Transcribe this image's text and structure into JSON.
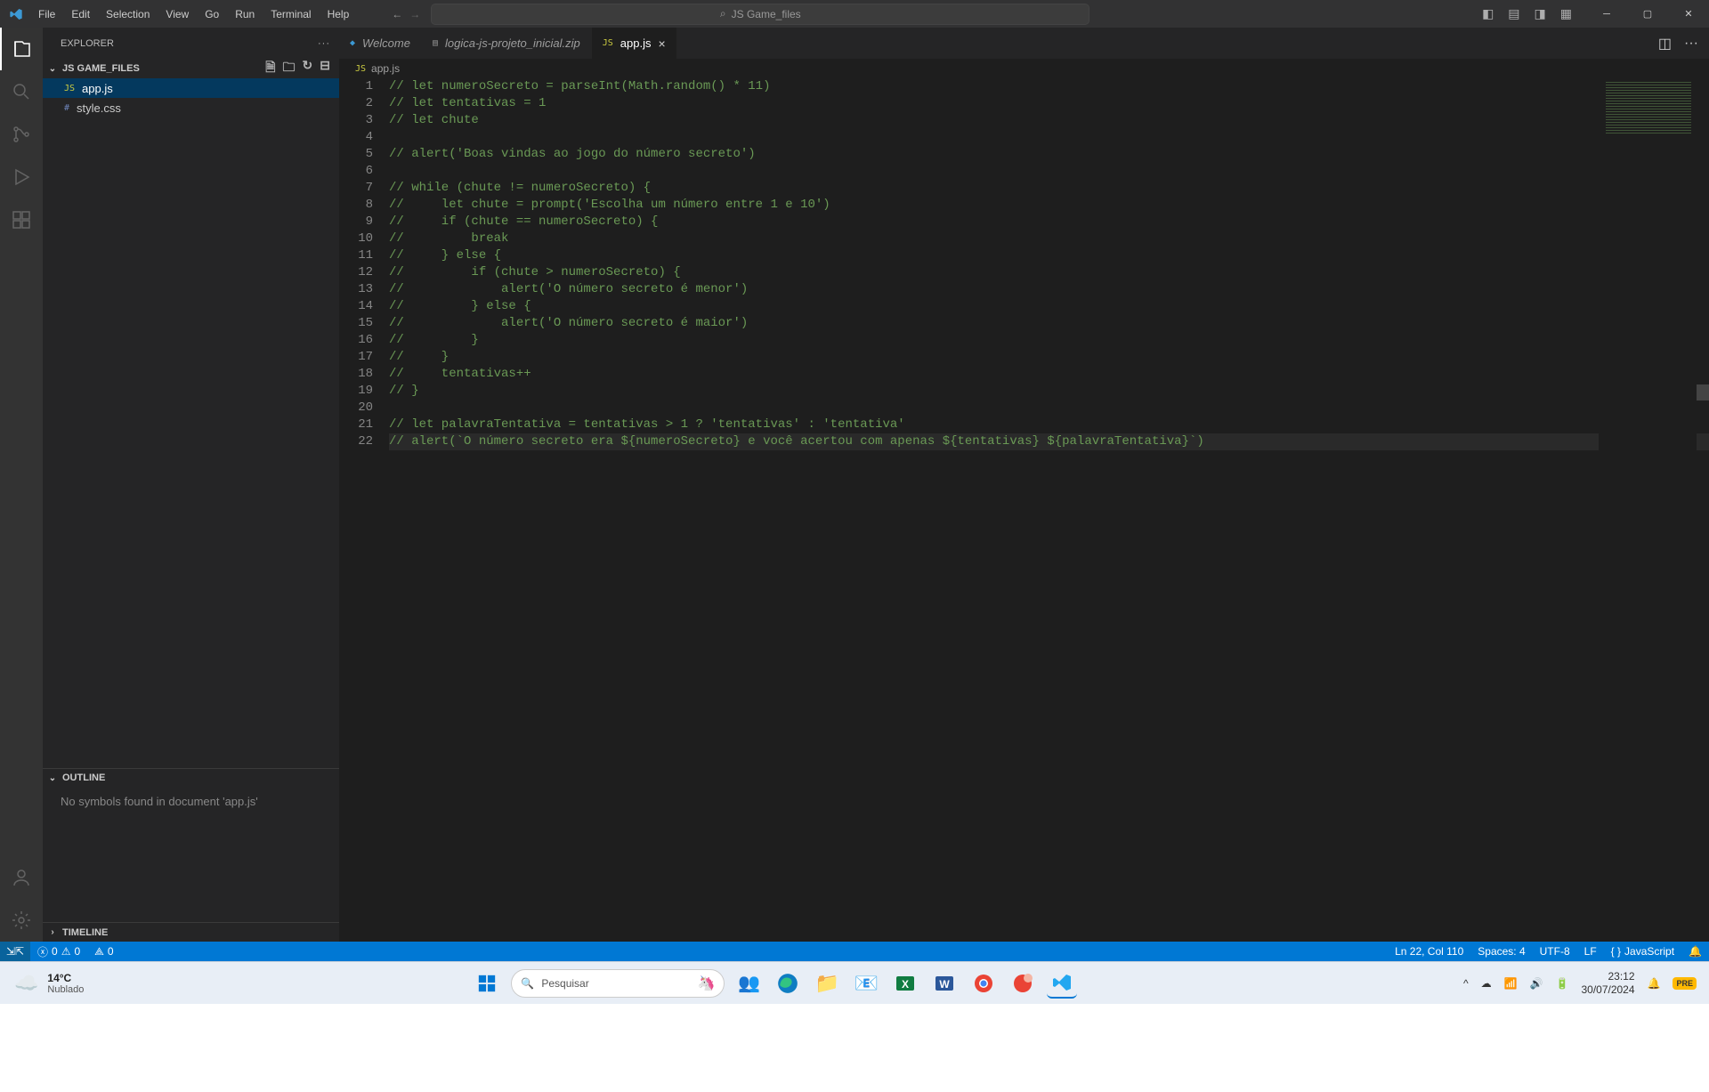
{
  "menu": [
    "File",
    "Edit",
    "Selection",
    "View",
    "Go",
    "Run",
    "Terminal",
    "Help"
  ],
  "search_placeholder": "JS Game_files",
  "sidebar": {
    "title": "EXPLORER",
    "folder": "JS GAME_FILES",
    "files": [
      {
        "icon": "JS",
        "name": "app.js",
        "active": true
      },
      {
        "icon": "#",
        "name": "style.css",
        "active": false
      }
    ],
    "outline": {
      "title": "OUTLINE",
      "message": "No symbols found in document 'app.js'"
    },
    "timeline": {
      "title": "TIMELINE"
    }
  },
  "tabs": [
    {
      "icon": "vs",
      "label": "Welcome",
      "active": false,
      "close": false
    },
    {
      "icon": "zip",
      "label": "logica-js-projeto_inicial.zip",
      "active": false,
      "close": false
    },
    {
      "icon": "js",
      "label": "app.js",
      "active": true,
      "close": true
    }
  ],
  "breadcrumb": {
    "icon": "JS",
    "label": "app.js"
  },
  "code": {
    "lines": [
      "// let numeroSecreto = parseInt(Math.random() * 11)",
      "// let tentativas = 1",
      "// let chute",
      "",
      "// alert('Boas vindas ao jogo do número secreto')",
      "",
      "// while (chute != numeroSecreto) {",
      "//     let chute = prompt('Escolha um número entre 1 e 10')",
      "//     if (chute == numeroSecreto) {",
      "//         break",
      "//     } else {",
      "//         if (chute > numeroSecreto) {",
      "//             alert('O número secreto é menor')",
      "//         } else {",
      "//             alert('O número secreto é maior')",
      "//         }",
      "//     }",
      "//     tentativas++",
      "// }",
      "",
      "// let palavraTentativa = tentativas > 1 ? 'tentativas' : 'tentativa'",
      "// alert(`O número secreto era ${numeroSecreto} e você acertou com apenas ${tentativas} ${palavraTentativa}`)"
    ],
    "current_line_index": 21
  },
  "status": {
    "errors": "0",
    "warnings": "0",
    "ports": "0",
    "position": "Ln 22, Col 110",
    "spaces": "Spaces: 4",
    "encoding": "UTF-8",
    "eol": "LF",
    "language": "JavaScript"
  },
  "taskbar": {
    "temperature": "14°C",
    "condition": "Nublado",
    "search": "Pesquisar",
    "time": "23:12",
    "date": "30/07/2024"
  }
}
